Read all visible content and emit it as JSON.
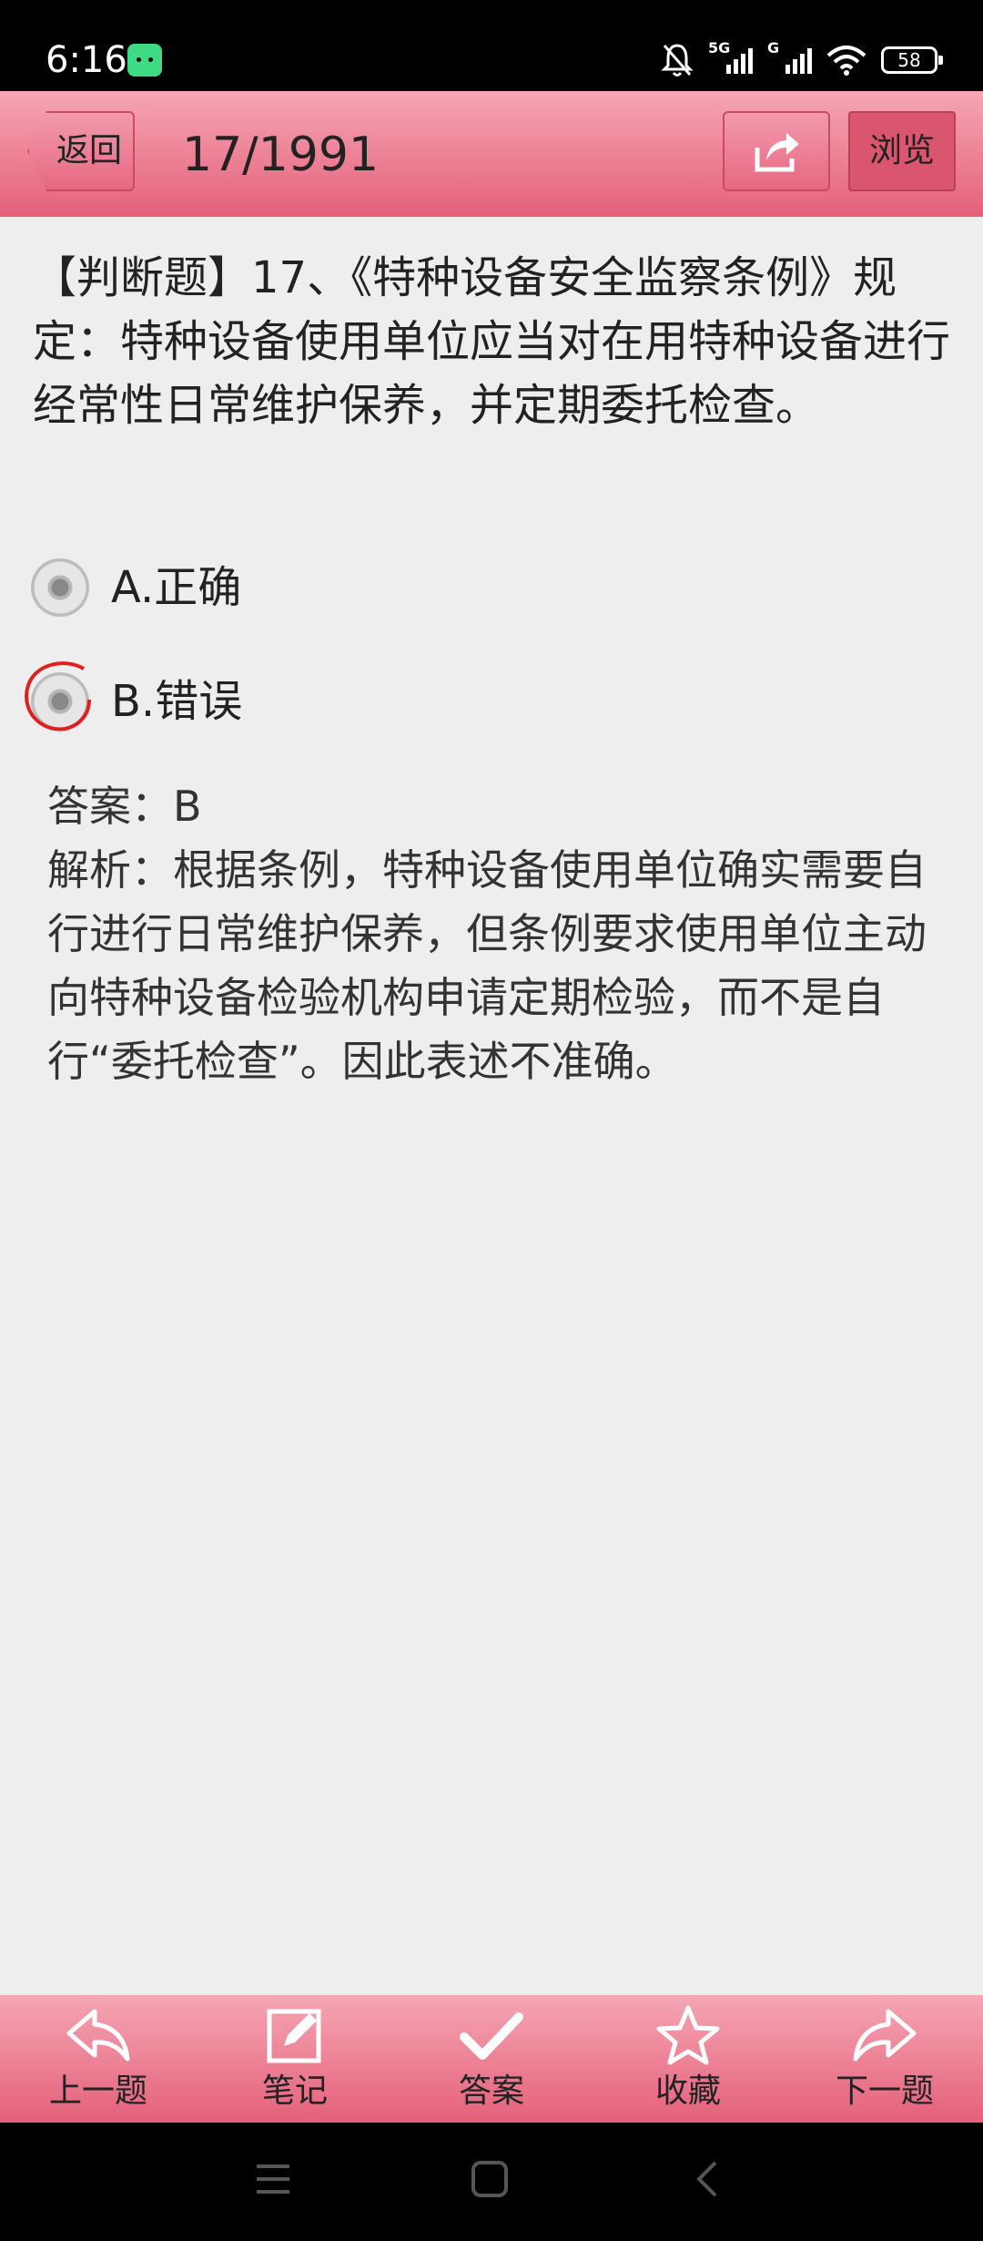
{
  "status": {
    "time": "6:16",
    "signal1": "5G",
    "signal2": "G",
    "battery": "58"
  },
  "header": {
    "back_label": "返回",
    "counter": "17/1991",
    "browse_label": "浏览"
  },
  "question": {
    "text": "【判断题】17、《特种设备安全监察条例》规定：特种设备使用单位应当对在用特种设备进行经常性日常维护保养，并定期委托检查。"
  },
  "options": [
    {
      "label": "A.正确",
      "selected": false
    },
    {
      "label": "B.错误",
      "selected": true
    }
  ],
  "answer": {
    "answer_line": "答案：B",
    "analysis": "解析：根据条例，特种设备使用单位确实需要自行进行日常维护保养，但条例要求使用单位主动向特种设备检验机构申请定期检验，而不是自行“委托检查”。因此表述不准确。"
  },
  "bottom_nav": [
    {
      "label": "上一题",
      "icon": "back-arrow-icon"
    },
    {
      "label": "笔记",
      "icon": "note-edit-icon"
    },
    {
      "label": "答案",
      "icon": "checkmark-icon"
    },
    {
      "label": "收藏",
      "icon": "star-icon"
    },
    {
      "label": "下一题",
      "icon": "forward-arrow-icon"
    }
  ],
  "colors": {
    "accent": "#e4607a",
    "accent_light": "#f5a6b4",
    "selected_ring": "#e02020"
  }
}
